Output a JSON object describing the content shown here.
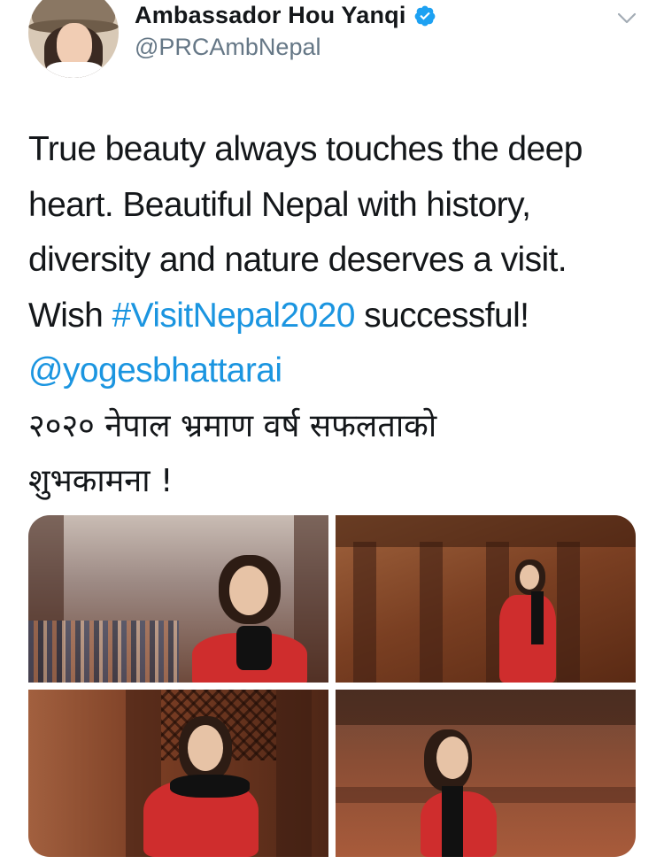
{
  "tweet": {
    "author": {
      "display_name": "Ambassador Hou Yanqi",
      "handle": "@PRCAmbNepal",
      "verified": true,
      "avatar_icon": "user-avatar-photo"
    },
    "text": {
      "line1": "True beauty always touches the deep",
      "line2": "heart.  Beautiful Nepal with history,",
      "line3": "diversity and nature deserves a visit.",
      "line4_prefix": "Wish ",
      "hashtag": "#VisitNepal2020",
      "line4_suffix": " successful!",
      "mention": "@yogesbhattarai",
      "nepali_line1": "२०२० नेपाल भ्रमाण वर्ष सफलताको",
      "nepali_line2": "शुभकामना !"
    },
    "media": [
      {
        "icon": "photo-woman-seated-durbar-square"
      },
      {
        "icon": "photo-woman-red-dress-carved-temple"
      },
      {
        "icon": "photo-woman-carved-window-seat"
      },
      {
        "icon": "photo-woman-red-dress-temple-facade"
      }
    ]
  },
  "colors": {
    "text": "#14171a",
    "secondary": "#657786",
    "link": "#1b95e0",
    "verified_badge": "#1da1f2"
  },
  "icons": {
    "verified": "verified-badge-icon",
    "menu": "chevron-down-icon"
  }
}
